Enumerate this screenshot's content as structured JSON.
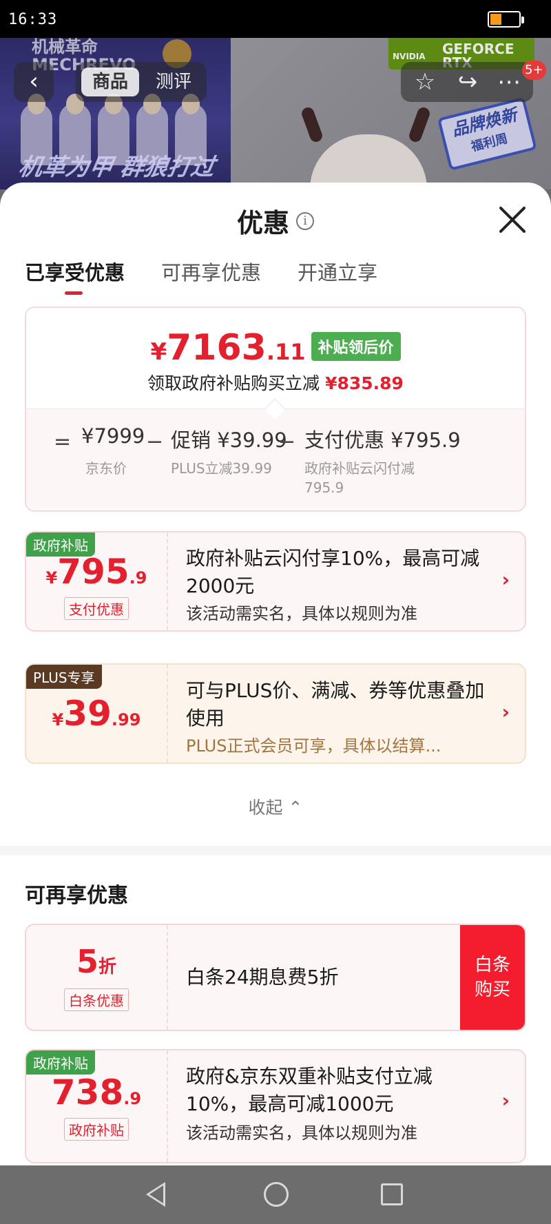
{
  "status_bar": {
    "time": "16:33"
  },
  "banner": {
    "brand_text": "机械革命\nMECHREVO",
    "slogan": "机革为甲 群狼打过",
    "gpu_brand": "GEFORCE\nRTX",
    "gpu_logo": "NVIDIA",
    "promo_line1": "品牌焕新",
    "promo_line2": "福利周"
  },
  "top_nav": {
    "back_icon": "chevron-left-icon",
    "tabs": [
      "商品",
      "测评"
    ],
    "actions": [
      "star-icon",
      "share-icon",
      "more-icon"
    ],
    "badge": "5+"
  },
  "sheet": {
    "title": "优惠",
    "info_icon": "i",
    "tabs": [
      "已享受优惠",
      "可再享优惠",
      "开通立享"
    ],
    "summary": {
      "symbol": "¥",
      "price_int": "7163",
      "price_dec": ".11",
      "tag": "补贴领后价",
      "saving_label": "领取政府补贴购买立减",
      "saving_amount": "¥835.89",
      "eq": "=",
      "base_price": "¥7999",
      "base_label": "京东价",
      "minus1": "−",
      "promo_value": "促销 ¥39.99",
      "promo_label": "PLUS立减39.99",
      "minus2": "−",
      "pay_value": "支付优惠 ¥795.9",
      "pay_label": "政府补贴云闪付减\n795.9"
    },
    "enjoyed": [
      {
        "tag": "政府补贴",
        "symbol": "¥",
        "amount_int": "795",
        "amount_dec": ".9",
        "label": "支付优惠",
        "desc": "政府补贴云闪付享10%，最高可减2000元",
        "note": "该活动需实名，具体以规则为准",
        "arrow": "›"
      },
      {
        "tag": "PLUS专享",
        "symbol": "¥",
        "amount_int": "39",
        "amount_dec": ".99",
        "desc": "可与PLUS价、满减、券等优惠叠加使用",
        "note": "PLUS正式会员可享，具体以结算...",
        "arrow": "›"
      }
    ],
    "collapse": "收起 ⌃",
    "more_section_title": "可再享优惠",
    "more": [
      {
        "amount_int": "5",
        "amount_unit": "折",
        "label": "白条优惠",
        "desc": "白条24期息费5折",
        "button": "白条\n购买"
      },
      {
        "tag": "政府补贴",
        "amount_int": "738",
        "amount_dec": ".9",
        "label": "政府补贴",
        "desc": "政府&京东双重补贴支付立减10%，最高可减1000元",
        "note": "该活动需实名，具体以规则为准",
        "arrow": "›"
      }
    ]
  },
  "nav_bar": {
    "icons": [
      "back-icon",
      "home-icon",
      "recent-apps-icon"
    ]
  },
  "colors": {
    "accent": "#e3202e",
    "green": "#4cae50",
    "plus_brown": "#5b3a24"
  }
}
